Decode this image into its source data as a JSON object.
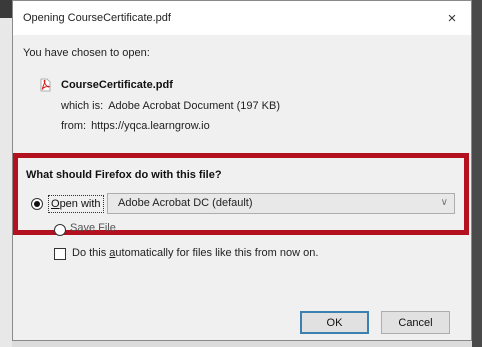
{
  "dialog": {
    "title": "Opening CourseCertificate.pdf",
    "close_symbol": "×"
  },
  "file": {
    "chosen_label": "You have chosen to open:",
    "name": "CourseCertificate.pdf",
    "icon": "pdf-file-icon",
    "which_label": "which is:",
    "which_value": "Adobe Acrobat Document (197 KB)",
    "from_label": "from:",
    "from_value": "https://yqca.learngrow.io"
  },
  "action": {
    "question": "What should Firefox do with this file?",
    "open_with": {
      "prefix": "",
      "underlined": "O",
      "rest": "pen with",
      "selected": true
    },
    "app_select": {
      "value": "Adobe Acrobat DC  (default)",
      "chevron": "∨"
    },
    "save_file": {
      "label": "Save File",
      "selected": false
    },
    "auto": {
      "label_before": "Do this ",
      "label_underlined": "a",
      "label_after": "utomatically for files like this from now on.",
      "checked": false
    },
    "highlight_color": "#b3111f"
  },
  "buttons": {
    "ok": "OK",
    "cancel": "Cancel"
  }
}
